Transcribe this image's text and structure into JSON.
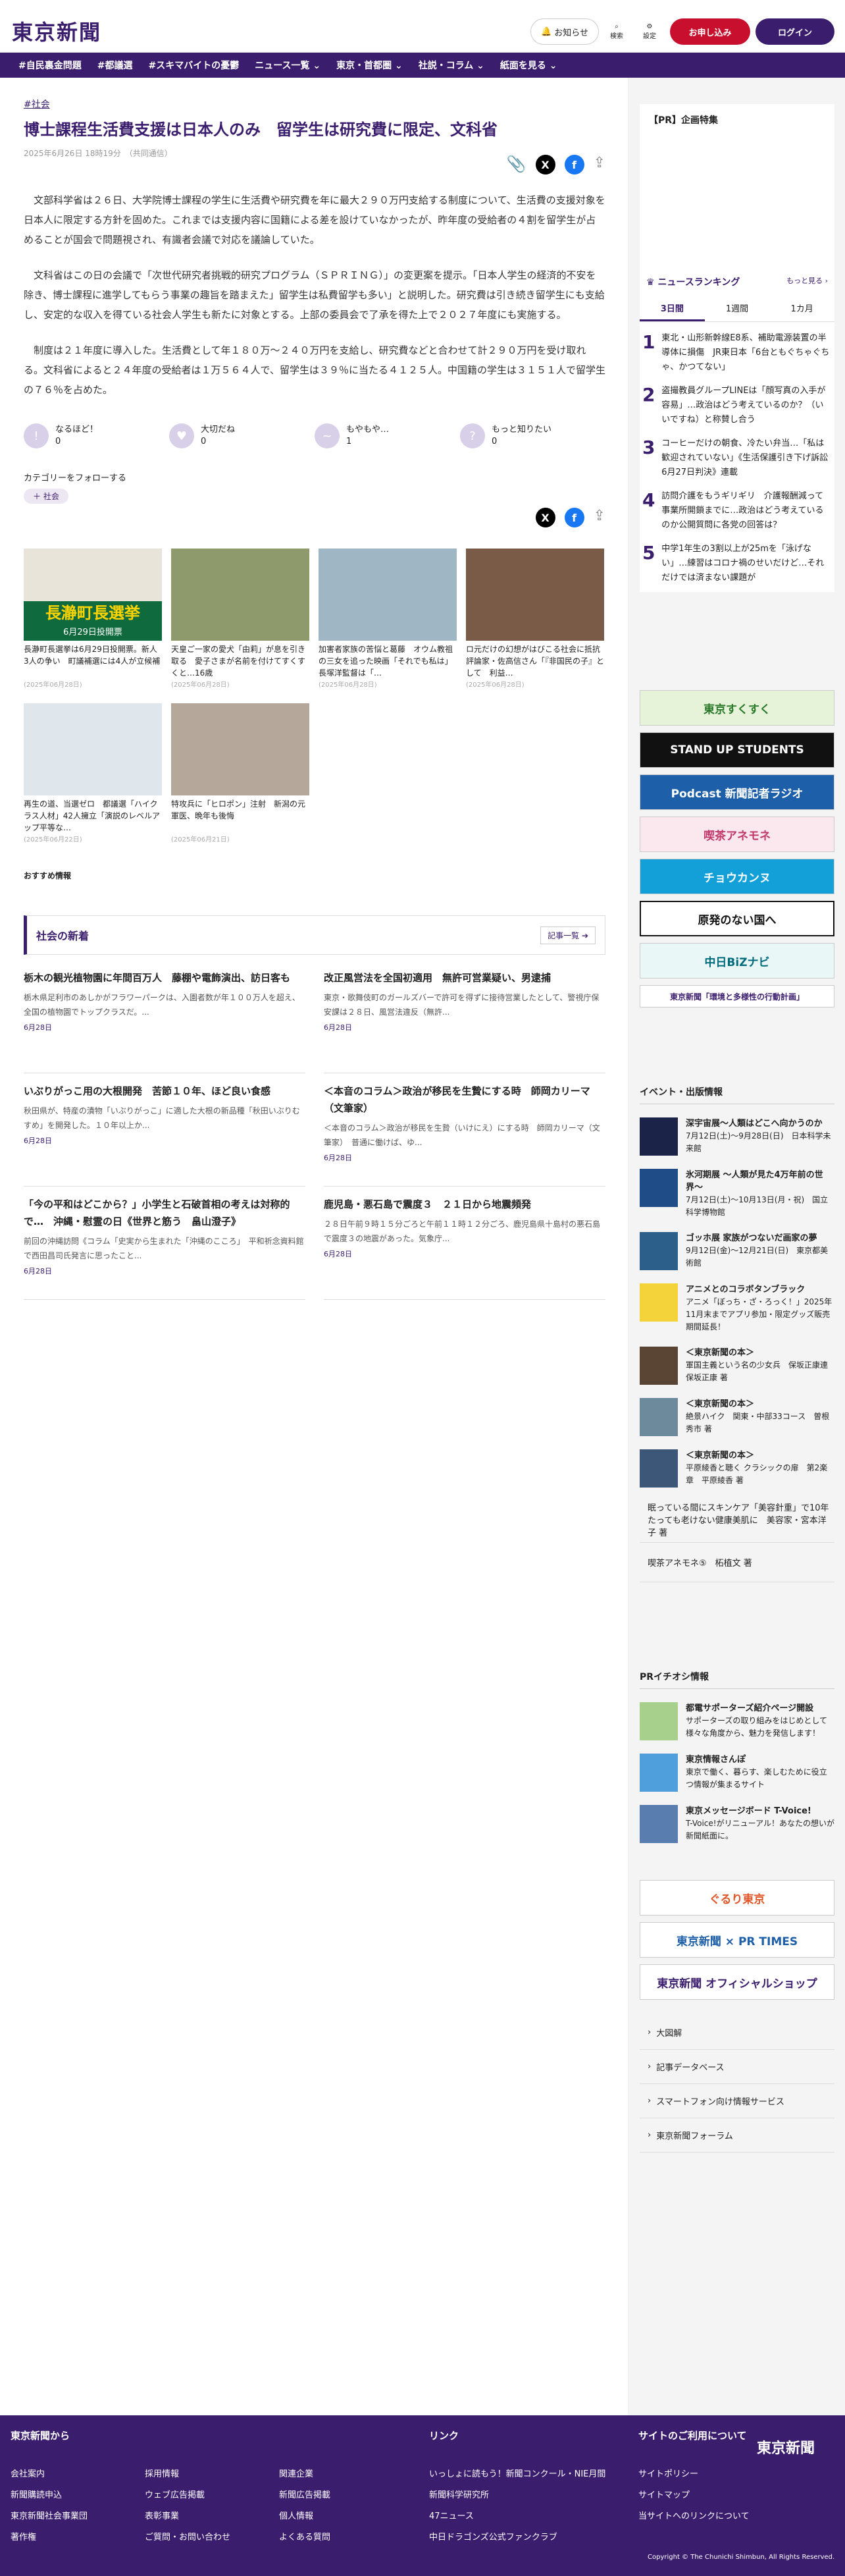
{
  "header": {
    "logo": "東京新聞",
    "notify": "お知らせ",
    "search": "検索",
    "settings": "設定",
    "apply": "お申し込み",
    "login": "ログイン"
  },
  "nav": [
    "#自民裏金問題",
    "#都議選",
    "#スキマバイトの憂鬱",
    "ニュース一覧 ⌄",
    "東京・首都圏 ⌄",
    "社説・コラム ⌄",
    "紙面を見る ⌄"
  ],
  "article": {
    "category": "#社会",
    "title": "博士課程生活費支援は日本人のみ　留学生は研究費に限定、文科省",
    "date": "2025年6月26日 18時19分　（共同通信）",
    "paragraphs": [
      "文部科学省は２６日、大学院博士課程の学生に生活費や研究費を年に最大２９０万円支給する制度について、生活費の支援対象を日本人に限定する方針を固めた。これまでは支援内容に国籍による差を設けていなかったが、昨年度の受給者の４割を留学生が占めることが国会で問題視され、有識者会議で対応を議論していた。",
      "文科省はこの日の会議で「次世代研究者挑戦的研究プログラム（ＳＰＲＩＮＧ）」の変更案を提示。「日本人学生の経済的不安を除き、博士課程に進学してもらう事業の趣旨を踏まえた」留学生は私費留学も多い」と説明した。研究費は引き続き留学生にも支給し、安定的な収入を得ている社会人学生も新たに対象とする。上部の委員会で了承を得た上で２０２７年度にも実施する。",
      "制度は２１年度に導入した。生活費として年１８０万〜２４０万円を支給し、研究費などと合わせて計２９０万円を受け取れる。文科省によると２４年度の受給者は１万５６４人で、留学生は３９％に当たる４１２５人。中国籍の学生は３１５１人で留学生の７６％を占めた。"
    ],
    "reactions": [
      {
        "label": "なるほど！",
        "count": "0",
        "icon": "!"
      },
      {
        "label": "大切だね",
        "count": "0",
        "icon": "♥"
      },
      {
        "label": "もやもや…",
        "count": "1",
        "icon": "~"
      },
      {
        "label": "もっと知りたい",
        "count": "0",
        "icon": "?"
      }
    ],
    "follow_label": "カテゴリーをフォローする",
    "follow_tag": "社会"
  },
  "related": [
    {
      "cap": "長瀞町長選挙は6月29日投開票。新人3人の争い　町議補選には4人が立候補",
      "date": "(2025年06月28日)",
      "banner": "長瀞町長選挙",
      "sub": "6月29日投開票"
    },
    {
      "cap": "天皇ご一家の愛犬「由莉」が息を引き取る　愛子さまが名前を付けてすくすくと…16歳",
      "date": "(2025年06月28日)"
    },
    {
      "cap": "加害者家族の苦悩と葛藤　オウム教祖の三女を追った映画「それでも私は」　長塚洋監督は「…",
      "date": "(2025年06月28日)"
    },
    {
      "cap": "ロ元だけの幻想がはびこる社会に抵抗　評論家・佐高信さん「『非国民の子』として　利益…",
      "date": "(2025年06月28日)"
    },
    {
      "cap": "再生の道、当選ゼロ　都議選「ハイクラス人材」42人擁立「演説のレベルアップ平等な…",
      "date": "(2025年06月22日)"
    },
    {
      "cap": "特攻兵に「ヒロポン」注射　新潟の元軍医、晩年も後悔",
      "date": "(2025年06月21日)"
    }
  ],
  "recommend_label": "おすすめ情報",
  "section": {
    "title": "社会の新着",
    "more": "記事一覧 ➔"
  },
  "news": [
    {
      "title": "栃木の観光植物園に年間百万人　藤棚や電飾演出、訪日客も",
      "text": "栃木県足利市のあしかがフラワーパークは、入園者数が年１００万人を超え、全国の植物園でトップクラスだ。...",
      "date": "6月28日"
    },
    {
      "title": "改正風営法を全国初適用　無許可営業疑い、男逮捕",
      "text": "東京・歌舞伎町のガールズバーで許可を得ずに接待営業したとして、警視庁保安課は２８日、風営法違反（無許...",
      "date": "6月28日"
    },
    {
      "title": "いぶりがっこ用の大根開発　苦節１０年、ほど良い食感",
      "text": "秋田県が、特産の漬物「いぶりがっこ」に適した大根の新品種「秋田いぶりむすめ」を開発した。１０年以上か...",
      "date": "6月28日"
    },
    {
      "title": "＜本音のコラム＞政治が移民を生贄にする時　師岡カリーマ（文筆家）",
      "text": "＜本音のコラム＞政治が移民を生贄（いけにえ）にする時　師岡カリーマ（文筆家）　普通に働けば、ゆ...",
      "date": "6月28日"
    },
    {
      "title": "「今の平和はどこから？」小学生と石破首相の考えは対称的で…　沖縄・慰霊の日《世界と筋う　畠山澄子》",
      "text": "前回の沖縄訪問《コラム「史実から生まれた「沖縄のこころ」　平和祈念資料館で西田昌司氏発言に思ったこと...",
      "date": "6月28日"
    },
    {
      "title": "鹿児島・悪石島で震度３　２１日から地震頻発",
      "text": "２８日午前９時１５分ごろと午前１１時１２分ごろ、鹿児島県十島村の悪石島で震度３の地震があった。気象庁...",
      "date": "6月28日"
    }
  ],
  "side": {
    "pr": "【PR】企画特集",
    "rank_title": "ニュースランキング",
    "rank_more": "もっと見る ›",
    "tabs": [
      "3日間",
      "1週間",
      "1カ月"
    ],
    "ranking": [
      "東北・山形新幹線E8系、補助電源装置の半導体に損傷　JR東日本「6台ともぐちゃぐちゃ、かつてない」",
      "盗撮教員グループLINEは「顔写真の入手が容易」…政治はどう考えているのか？（いいですね）と称賛し合う",
      "コーヒーだけの朝食、冷たい弁当…「私は歓迎されていない」《生活保護引き下げ訴訟6月27日判決》連載",
      "訪問介護をもうギリギリ　介護報酬減って事業所開鎖までに…政治はどう考えているのか公開質問に各党の回答は？",
      "中学1年生の3割以上が25mを「泳げない」…練習はコロナ禍のせいだけど…それだけでは済まない課題が"
    ],
    "banners": [
      "東京すくすく",
      "STAND UP STUDENTS",
      "Podcast 新聞記者ラジオ",
      "喫茶アネモネ",
      "チョウカンヌ",
      "原発のない国へ",
      "中日BiZナビ",
      "東京新聞「環境と多様性の行動計画」"
    ],
    "events_title": "イベント・出版情報",
    "events": [
      {
        "t": "深宇宙展〜人類はどこへ向かうのか",
        "s": "7月12日(土)〜9月28日(日)　日本科学未来館"
      },
      {
        "t": "氷河期展 〜人類が見た4万年前の世界〜",
        "s": "7月12日(土)〜10月13日(月・祝)　国立科学博物館"
      },
      {
        "t": "ゴッホ展 家族がつないだ画家の夢",
        "s": "9月12日(金)〜12月21日(日)　東京都美術館"
      },
      {
        "t": "アニメとのコラボタンブラック",
        "s": "アニメ「ぼっち・ざ・ろっく！」2025年11月末までアプリ参加・限定グッズ販売期間延長！"
      },
      {
        "t": "＜東京新聞の本＞",
        "s": "軍国主義という名の少女兵　保坂正康連　保坂正康 著"
      },
      {
        "t": "＜東京新聞の本＞",
        "s": "絶景ハイク　関東・中部33コース　曽根秀市 著"
      },
      {
        "t": "＜東京新聞の本＞",
        "s": "平原綾香と聴く クラシックの扉　第2楽章　平原綾香 著"
      }
    ],
    "links_text": [
      "眠っている間にスキンケア「美容針重」で10年たっても老けない健康美肌に　美容家・宮本洋子 著",
      "喫茶アネモネ⑤　柘植文 著"
    ],
    "pr_title": "PRイチオシ情報",
    "pr_items": [
      {
        "t": "都電サポーターズ紹介ページ開設",
        "s": "サポーターズの取り組みをはじめとして様々な角度から、魅力を発信します！"
      },
      {
        "t": "東京情報さんぽ",
        "s": "東京で働く、暮らす、楽しむために役立つ情報が集まるサイト"
      },
      {
        "t": "東京メッセージボード T-Voice!",
        "s": "T-Voice!がリニューアル！あなたの想いが新聞紙面に。"
      }
    ],
    "pr_banners": [
      "ぐるり東京",
      "東京新聞 × PR TIMES",
      "東京新聞 オフィシャルショップ"
    ],
    "links": [
      "大図解",
      "記事データベース",
      "スマートフォン向け情報サービス",
      "東京新聞フォーラム"
    ]
  },
  "footer": {
    "h1": "東京新聞から",
    "h2": "リンク",
    "h3": "サイトのご利用について",
    "logo": "東京新聞",
    "c1": [
      "会社案内",
      "新聞購読申込",
      "東京新聞社会事業団",
      "著作権"
    ],
    "c2": [
      "採用情報",
      "ウェブ広告掲載",
      "表彰事業",
      "ご質問・お問い合わせ"
    ],
    "c3": [
      "関連企業",
      "新聞広告掲載",
      "個人情報",
      "よくある質問"
    ],
    "c4": [
      "いっしょに読もう！新聞コンクール・NIE月間",
      "新聞科学研究所",
      "47ニュース",
      "中日ドラゴンズ公式ファンクラブ"
    ],
    "c5": [
      "サイトポリシー",
      "サイトマップ",
      "当サイトへのリンクについて"
    ],
    "copy": "Copyright © The Chunichi Shimbun, All Rights Reserved."
  }
}
